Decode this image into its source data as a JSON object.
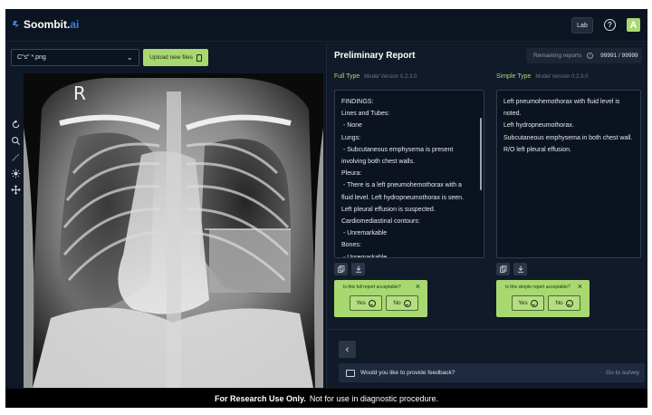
{
  "header": {
    "logo_name": "Soombit.",
    "logo_suffix": "ai",
    "lab_label": "Lab",
    "help_icon": "question-circle-icon",
    "avatar_letter": "A"
  },
  "viewer": {
    "file_selected": "C\"s\" *.png",
    "upload_label": "Upload new files",
    "image_marker": "R",
    "tools": [
      "rotate-icon",
      "zoom-icon",
      "measure-icon",
      "brightness-icon",
      "move-icon"
    ]
  },
  "report": {
    "title": "Preliminary Report",
    "remaining_label": "Remaining reports",
    "remaining_value": "99991 / 99999",
    "full": {
      "heading": "Full Type",
      "version": "Model Version 0.2.3.0",
      "lines": [
        "FINDINGS:",
        "Lines and Tubes:",
        " - None",
        "Lungs:",
        " - Subcutaneous emphysema is present",
        "involving both chest walls.",
        "Pleura:",
        " - There is a left pneumohemothorax with a",
        "fluid level. Left hydropneumothorax is seen.",
        "Left pleural effusion is suspected.",
        "Cardiomediastinal contours:",
        " - Unremarkable",
        "Bones:",
        " - Unremarkable"
      ],
      "question": "Is this full report acceptable?",
      "yes": "Yes",
      "no": "No"
    },
    "simple": {
      "heading": "Simple Type",
      "version": "Model Version 0.2.3.0",
      "lines": [
        "Left pneumohemothorax with fluid level is",
        "noted.",
        "Left hydropneumothorax.",
        "Subcutaneous emphysema in both chest wall.",
        "R/O left pleural effusion."
      ],
      "question": "Is this simple report acceptable?",
      "yes": "Yes",
      "no": "No"
    },
    "feedback_prompt": "Would you like to provide feedback?",
    "survey_link": "Go to survey"
  },
  "footer": {
    "bold": "For Research Use Only.",
    "rest": "Not for use in diagnostic procedure."
  },
  "colors": {
    "accent": "#a8d870",
    "background": "#0d1522",
    "panel": "#111a28"
  }
}
